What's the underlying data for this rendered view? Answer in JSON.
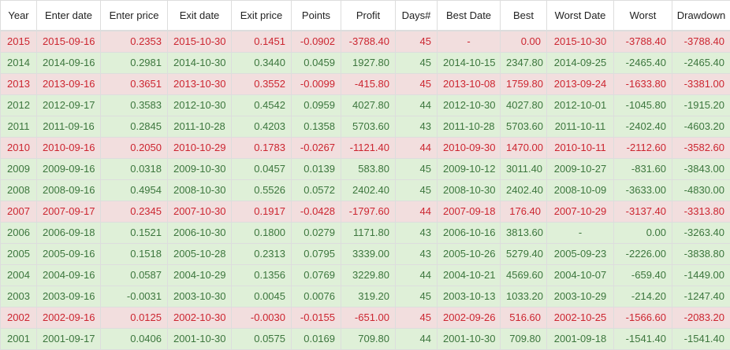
{
  "table": {
    "columns": [
      "Year",
      "Enter date",
      "Enter price",
      "Exit date",
      "Exit price",
      "Points",
      "Profit",
      "Days#",
      "Best Date",
      "Best",
      "Worst Date",
      "Worst",
      "Drawdown"
    ],
    "rows": [
      {
        "status": "loss",
        "cells": [
          "2015",
          "2015-09-16",
          "0.2353",
          "2015-10-30",
          "0.1451",
          "-0.0902",
          "-3788.40",
          "45",
          "-",
          "0.00",
          "2015-10-30",
          "-3788.40",
          "-3788.40"
        ]
      },
      {
        "status": "win",
        "cells": [
          "2014",
          "2014-09-16",
          "0.2981",
          "2014-10-30",
          "0.3440",
          "0.0459",
          "1927.80",
          "45",
          "2014-10-15",
          "2347.80",
          "2014-09-25",
          "-2465.40",
          "-2465.40"
        ]
      },
      {
        "status": "loss",
        "cells": [
          "2013",
          "2013-09-16",
          "0.3651",
          "2013-10-30",
          "0.3552",
          "-0.0099",
          "-415.80",
          "45",
          "2013-10-08",
          "1759.80",
          "2013-09-24",
          "-1633.80",
          "-3381.00"
        ]
      },
      {
        "status": "win",
        "cells": [
          "2012",
          "2012-09-17",
          "0.3583",
          "2012-10-30",
          "0.4542",
          "0.0959",
          "4027.80",
          "44",
          "2012-10-30",
          "4027.80",
          "2012-10-01",
          "-1045.80",
          "-1915.20"
        ]
      },
      {
        "status": "win",
        "cells": [
          "2011",
          "2011-09-16",
          "0.2845",
          "2011-10-28",
          "0.4203",
          "0.1358",
          "5703.60",
          "43",
          "2011-10-28",
          "5703.60",
          "2011-10-11",
          "-2402.40",
          "-4603.20"
        ]
      },
      {
        "status": "loss",
        "cells": [
          "2010",
          "2010-09-16",
          "0.2050",
          "2010-10-29",
          "0.1783",
          "-0.0267",
          "-1121.40",
          "44",
          "2010-09-30",
          "1470.00",
          "2010-10-11",
          "-2112.60",
          "-3582.60"
        ]
      },
      {
        "status": "win",
        "cells": [
          "2009",
          "2009-09-16",
          "0.0318",
          "2009-10-30",
          "0.0457",
          "0.0139",
          "583.80",
          "45",
          "2009-10-12",
          "3011.40",
          "2009-10-27",
          "-831.60",
          "-3843.00"
        ]
      },
      {
        "status": "win",
        "cells": [
          "2008",
          "2008-09-16",
          "0.4954",
          "2008-10-30",
          "0.5526",
          "0.0572",
          "2402.40",
          "45",
          "2008-10-30",
          "2402.40",
          "2008-10-09",
          "-3633.00",
          "-4830.00"
        ]
      },
      {
        "status": "loss",
        "cells": [
          "2007",
          "2007-09-17",
          "0.2345",
          "2007-10-30",
          "0.1917",
          "-0.0428",
          "-1797.60",
          "44",
          "2007-09-18",
          "176.40",
          "2007-10-29",
          "-3137.40",
          "-3313.80"
        ]
      },
      {
        "status": "win",
        "cells": [
          "2006",
          "2006-09-18",
          "0.1521",
          "2006-10-30",
          "0.1800",
          "0.0279",
          "1171.80",
          "43",
          "2006-10-16",
          "3813.60",
          "-",
          "0.00",
          "-3263.40"
        ]
      },
      {
        "status": "win",
        "cells": [
          "2005",
          "2005-09-16",
          "0.1518",
          "2005-10-28",
          "0.2313",
          "0.0795",
          "3339.00",
          "43",
          "2005-10-26",
          "5279.40",
          "2005-09-23",
          "-2226.00",
          "-3838.80"
        ]
      },
      {
        "status": "win",
        "cells": [
          "2004",
          "2004-09-16",
          "0.0587",
          "2004-10-29",
          "0.1356",
          "0.0769",
          "3229.80",
          "44",
          "2004-10-21",
          "4569.60",
          "2004-10-07",
          "-659.40",
          "-1449.00"
        ]
      },
      {
        "status": "win",
        "cells": [
          "2003",
          "2003-09-16",
          "-0.0031",
          "2003-10-30",
          "0.0045",
          "0.0076",
          "319.20",
          "45",
          "2003-10-13",
          "1033.20",
          "2003-10-29",
          "-214.20",
          "-1247.40"
        ]
      },
      {
        "status": "loss",
        "cells": [
          "2002",
          "2002-09-16",
          "0.0125",
          "2002-10-30",
          "-0.0030",
          "-0.0155",
          "-651.00",
          "45",
          "2002-09-26",
          "516.60",
          "2002-10-25",
          "-1566.60",
          "-2083.20"
        ]
      },
      {
        "status": "win",
        "cells": [
          "2001",
          "2001-09-17",
          "0.0406",
          "2001-10-30",
          "0.0575",
          "0.0169",
          "709.80",
          "44",
          "2001-10-30",
          "709.80",
          "2001-09-18",
          "-1541.40",
          "-1541.40"
        ]
      }
    ]
  }
}
